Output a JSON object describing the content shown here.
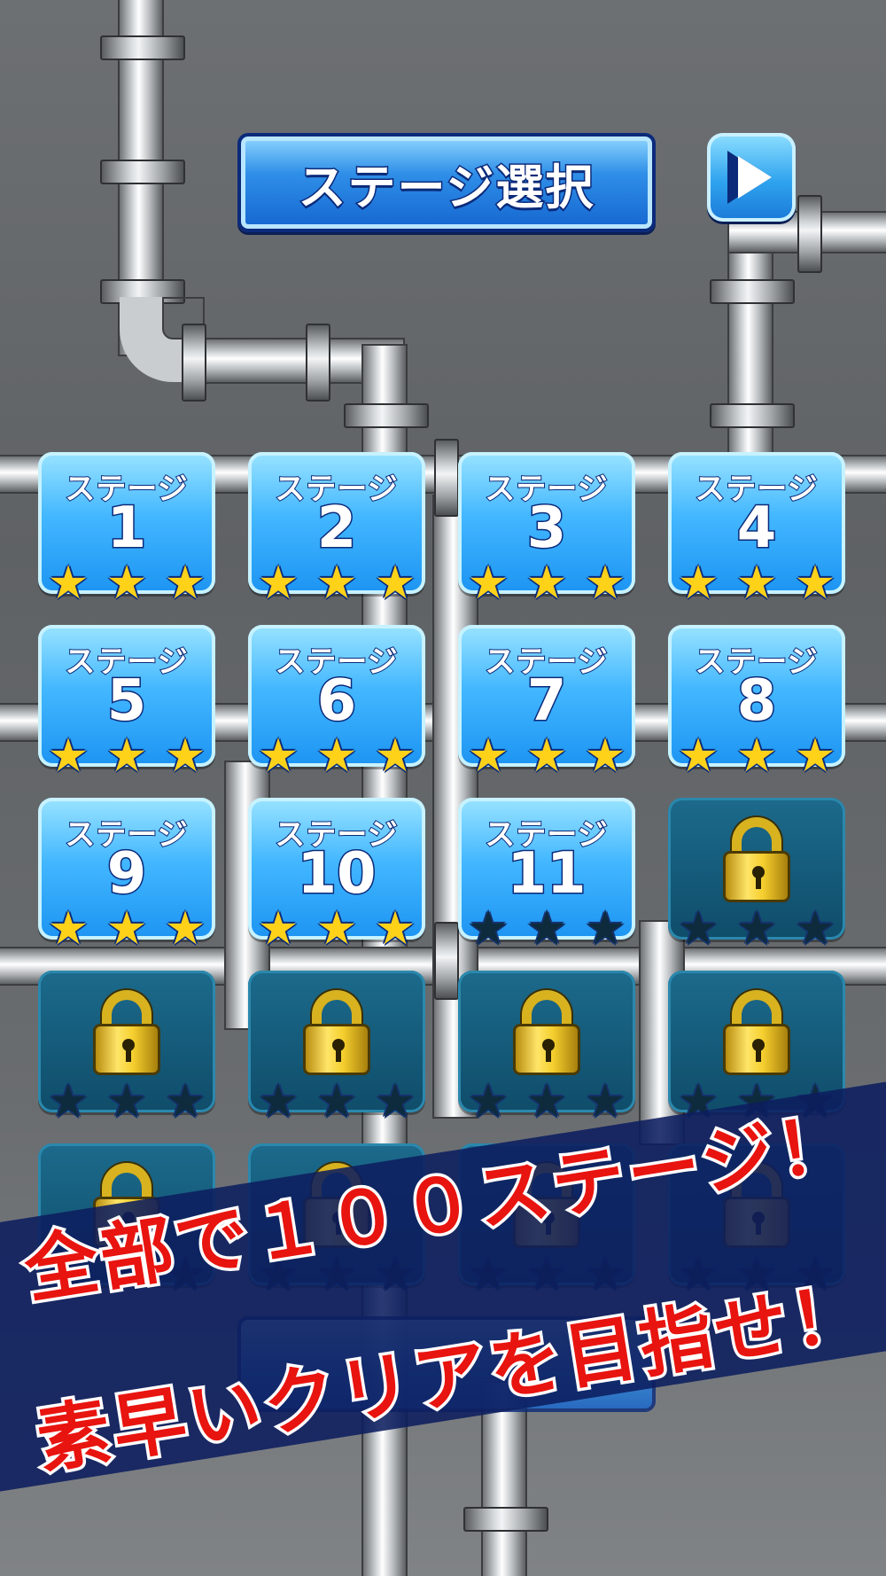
{
  "header": {
    "title": "ステージ選択",
    "next_icon": "play-triangle-icon"
  },
  "stages": [
    {
      "label": "ステージ",
      "number": "1",
      "locked": false,
      "stars": 3
    },
    {
      "label": "ステージ",
      "number": "2",
      "locked": false,
      "stars": 3
    },
    {
      "label": "ステージ",
      "number": "3",
      "locked": false,
      "stars": 3
    },
    {
      "label": "ステージ",
      "number": "4",
      "locked": false,
      "stars": 3
    },
    {
      "label": "ステージ",
      "number": "5",
      "locked": false,
      "stars": 3
    },
    {
      "label": "ステージ",
      "number": "6",
      "locked": false,
      "stars": 3
    },
    {
      "label": "ステージ",
      "number": "7",
      "locked": false,
      "stars": 3
    },
    {
      "label": "ステージ",
      "number": "8",
      "locked": false,
      "stars": 3
    },
    {
      "label": "ステージ",
      "number": "9",
      "locked": false,
      "stars": 3
    },
    {
      "label": "ステージ",
      "number": "10",
      "locked": false,
      "stars": 3
    },
    {
      "label": "ステージ",
      "number": "11",
      "locked": false,
      "stars": 0
    },
    {
      "label": "",
      "number": "",
      "locked": true,
      "stars": 0
    },
    {
      "label": "",
      "number": "",
      "locked": true,
      "stars": 0
    },
    {
      "label": "",
      "number": "",
      "locked": true,
      "stars": 0
    },
    {
      "label": "",
      "number": "",
      "locked": true,
      "stars": 0
    },
    {
      "label": "",
      "number": "",
      "locked": true,
      "stars": 0
    },
    {
      "label": "",
      "number": "",
      "locked": true,
      "stars": 0
    },
    {
      "label": "",
      "number": "",
      "locked": true,
      "stars": 0
    },
    {
      "label": "",
      "number": "",
      "locked": true,
      "stars": 0
    },
    {
      "label": "",
      "number": "",
      "locked": true,
      "stars": 0
    }
  ],
  "promo": {
    "line1": "全部で１００ステージ！",
    "line2": "素早いクリアを目指せ！"
  },
  "colors": {
    "tile_open": "#43b7ff",
    "tile_locked": "#0f4d6a",
    "star_gold": "#ffd21a",
    "promo_text": "#e8140f",
    "banner": "#0c1e5f"
  }
}
